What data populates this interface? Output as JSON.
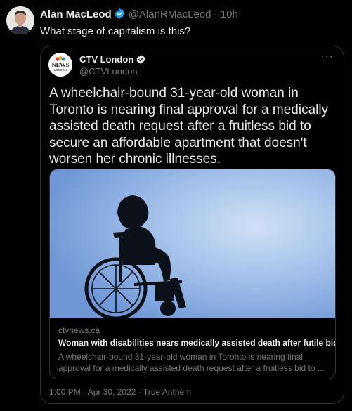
{
  "tweet": {
    "author_name": "Alan MacLeod",
    "author_handle": "@AlanRMacLeod",
    "separator": "·",
    "time": "10h",
    "text": "What stage of capitalism is this?",
    "verified_color": "#1d9bf0"
  },
  "quoted_tweet": {
    "logo_text_top": "NEWS",
    "logo_text_bottom": "LONDON",
    "author_name": "CTV London",
    "author_handle": "@CTVLondon",
    "more_label": "···",
    "body": "A wheelchair-bound 31-year-old woman in Toronto is nearing final approval for a medically assisted death request after a fruitless bid to secure an affordable apartment that doesn't worsen her chronic illnesses.",
    "link_card": {
      "domain": "ctvnews.ca",
      "title": "Woman with disabilities nears medically assisted death after futile bid f...",
      "description": "A wheelchair-bound 31-year-old woman in Toronto is nearing final approval for a medically assisted death request after a fruitless bid to ..."
    },
    "footer": {
      "time": "1:00 PM",
      "separator1": "·",
      "date": "Apr 30, 2022",
      "separator2": "·",
      "source": "True Anthem"
    }
  }
}
